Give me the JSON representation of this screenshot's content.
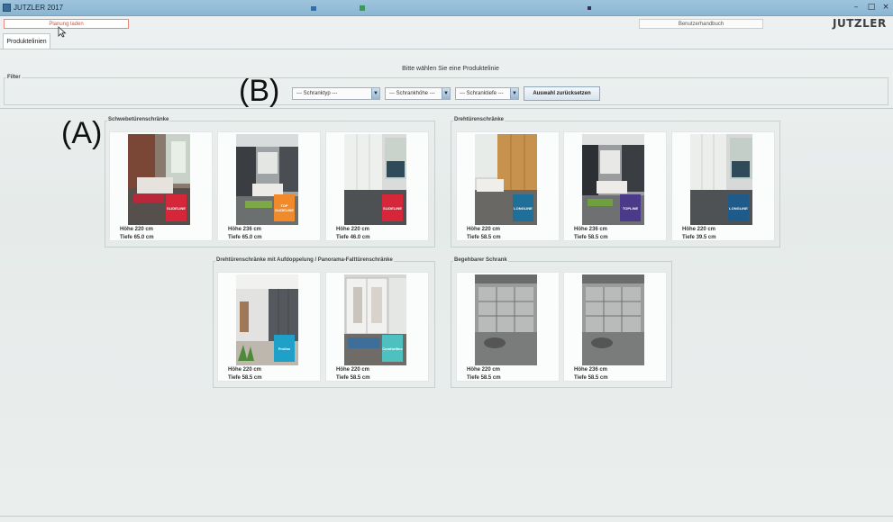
{
  "window": {
    "title": "JUTZLER 2017"
  },
  "topbar": {
    "load_label": "Planung laden",
    "manual_label": "Benutzerhandbuch",
    "logo": "JUTZLER"
  },
  "tabs": [
    {
      "label": "Produktelinien"
    }
  ],
  "prompt": "Bitte wählen Sie eine Produktelinie",
  "filter": {
    "label": "Filter",
    "type_select": "--- Schranktyp ---",
    "height_select": "--- Schrankhöhe ---",
    "depth_select": "--- Schranktiefe ---",
    "reset_label": "Auswahl zurücksetzen"
  },
  "annotations": {
    "a": "(A)",
    "b": "(B)"
  },
  "groups": [
    {
      "title": "Schwebetürenschränke",
      "cards": [
        {
          "height": "Höhe 220 cm",
          "depth": "Tiefe 65.0 cm",
          "badge": "SLIDELINE",
          "badge_color": "#d6263a",
          "scene": "bedroom-brick"
        },
        {
          "height": "Höhe 236 cm",
          "depth": "Tiefe 65.0 cm",
          "badge": "TOP SLIDELINE",
          "badge_color": "#f08a2a",
          "scene": "bedroom-dark"
        },
        {
          "height": "Höhe 220 cm",
          "depth": "Tiefe 46.0 cm",
          "badge": "SLIDELINE",
          "badge_color": "#d6263a",
          "scene": "room-white"
        }
      ]
    },
    {
      "title": "Drehtürenschränke",
      "cards": [
        {
          "height": "Höhe 220 cm",
          "depth": "Tiefe 58.5 cm",
          "badge": "LONGLINE",
          "badge_color": "#1e6f9a",
          "scene": "bedroom-wood"
        },
        {
          "height": "Höhe 236 cm",
          "depth": "Tiefe 58.5 cm",
          "badge": "TOPLINE",
          "badge_color": "#4b3a8a",
          "scene": "bedroom-dark"
        },
        {
          "height": "Höhe 220 cm",
          "depth": "Tiefe 39.5 cm",
          "badge": "LONGLINE",
          "badge_color": "#1e5a8a",
          "scene": "room-white"
        }
      ]
    },
    {
      "title": "Drehtürenschränke mit Aufdoppelung / Panorama-Falttürenschränke",
      "cards": [
        {
          "height": "Höhe 220 cm",
          "depth": "Tiefe 58.5 cm",
          "badge": "Proline",
          "badge_color": "#1ea0c8",
          "scene": "room-grey"
        },
        {
          "height": "Höhe 220 cm",
          "depth": "Tiefe 58.5 cm",
          "badge": "Comfortline",
          "badge_color": "#4ec0c0",
          "scene": "room-shelf"
        }
      ]
    },
    {
      "title": "Begehbarer Schrank",
      "cards": [
        {
          "height": "Höhe 220 cm",
          "depth": "Tiefe 58.5 cm",
          "badge": "",
          "badge_color": "",
          "scene": "walkin"
        },
        {
          "height": "Höhe 236 cm",
          "depth": "Tiefe 58.5 cm",
          "badge": "",
          "badge_color": "",
          "scene": "walkin"
        }
      ]
    }
  ]
}
